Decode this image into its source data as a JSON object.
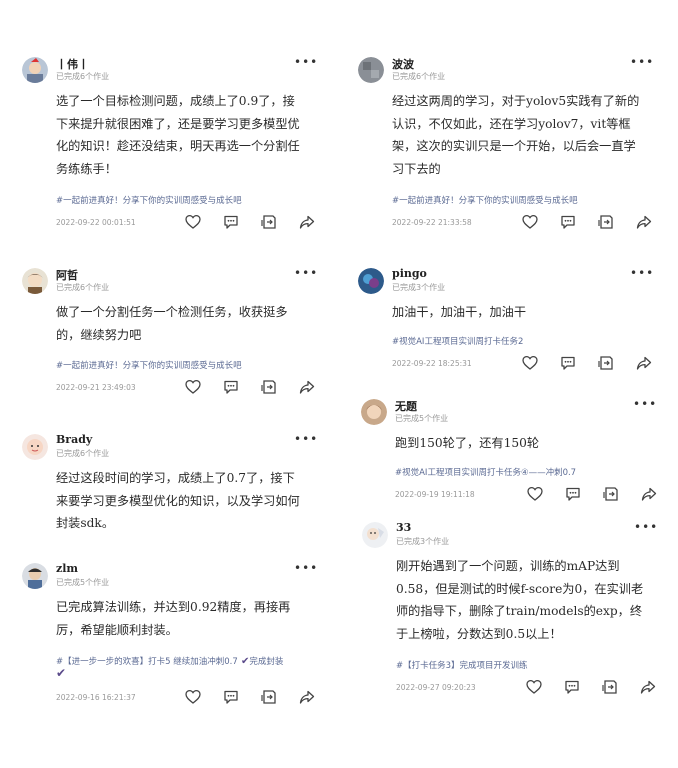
{
  "colors": {
    "tag": "#5b6a93",
    "meta": "#999999",
    "text": "#2a2a2a",
    "icon": "#444444"
  },
  "icons": [
    "like-icon",
    "comment-icon",
    "repost-icon",
    "share-icon",
    "more-icon"
  ],
  "more_label": "•••",
  "posts": [
    {
      "user": "丨伟丨",
      "progress": "已完成6个作业",
      "content": "选了一个目标检测问题，成绩上了0.9了，接下来提升就很困难了，还是要学习更多模型优化的知识！趁还没结束，明天再选一个分割任务练练手！",
      "tag": "#一起前进真好！分享下你的实训周感受与成长吧",
      "time": "2022-09-22 00:01:51"
    },
    {
      "user": "阿哲",
      "progress": "已完成6个作业",
      "content": "做了一个分割任务一个检测任务，收获挺多的，继续努力吧",
      "tag": "#一起前进真好！分享下你的实训周感受与成长吧",
      "time": "2022-09-21 23:49:03"
    },
    {
      "user": "Brady",
      "progress": "已完成6个作业",
      "content": "经过这段时间的学习，成绩上了0.7了，接下来要学习更多模型优化的知识，以及学习如何封装sdk。"
    },
    {
      "user": "zlm",
      "progress": "已完成5个作业",
      "content": "已完成算法训练，并达到0.92精度，再接再厉，希望能顺利封装。",
      "tag": "#【进一步一步的欢喜】打卡5 继续加油冲刺0.7",
      "tag_suffix": "完成封装",
      "time": "2022-09-16 16:21:37"
    },
    {
      "user": "波波",
      "progress": "已完成6个作业",
      "content": "经过这两周的学习，对于yolov5实践有了新的认识，不仅如此，还在学习yolov7，vit等框架，这次的实训只是一个开始，以后会一直学习下去的",
      "tag": "#一起前进真好！分享下你的实训周感受与成长吧",
      "time": "2022-09-22 21:33:58"
    },
    {
      "user": "pingo",
      "progress": "已完成3个作业",
      "content": "加油干，加油干，加油干",
      "tag": "#视觉AI工程项目实训周打卡任务2",
      "time": "2022-09-22 18:25:31"
    },
    {
      "user": "无题",
      "progress": "已完成5个作业",
      "content": "跑到150轮了，还有150轮",
      "tag": "#视觉AI工程项目实训周打卡任务④——冲刺0.7",
      "time": "2022-09-19 19:11:18"
    },
    {
      "user": "33",
      "progress": "已完成3个作业",
      "content": "刚开始遇到了一个问题，训练的mAP达到0.58，但是测试的时候f-score为0，在实训老师的指导下，删除了train/models的exp，终于上榜啦，分数达到0.5以上！",
      "tag": "#【打卡任务3】完成项目开发训练",
      "time": "2022-09-27 09:20:23"
    }
  ]
}
